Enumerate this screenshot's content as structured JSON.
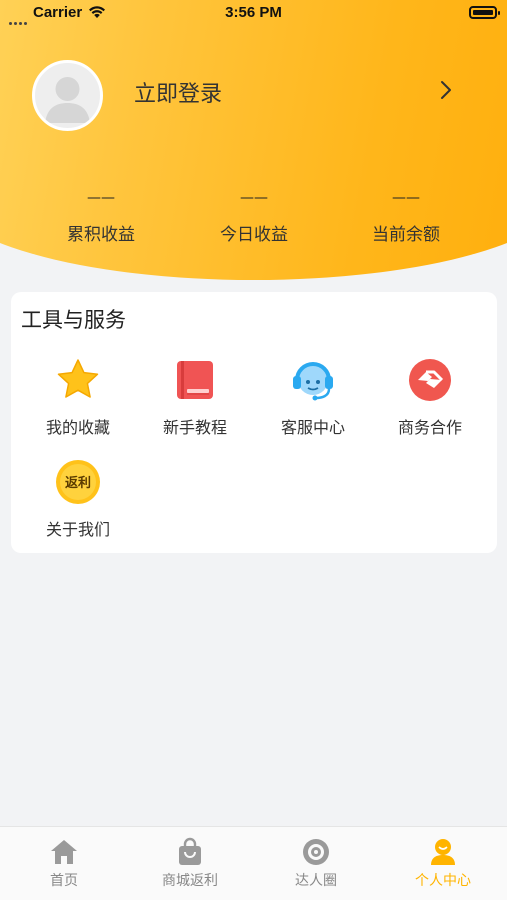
{
  "status_bar": {
    "carrier": "Carrier",
    "time": "3:56 PM"
  },
  "profile": {
    "login_label": "立即登录"
  },
  "stats": [
    {
      "value": "——",
      "label": "累积收益"
    },
    {
      "value": "——",
      "label": "今日收益"
    },
    {
      "value": "——",
      "label": "当前余额"
    }
  ],
  "tools": {
    "title": "工具与服务",
    "items": [
      {
        "label": "我的收藏",
        "icon": "star-icon"
      },
      {
        "label": "新手教程",
        "icon": "book-icon"
      },
      {
        "label": "客服中心",
        "icon": "customer-service-icon"
      },
      {
        "label": "商务合作",
        "icon": "handshake-icon"
      },
      {
        "label": "关于我们",
        "icon": "rebate-badge-icon",
        "badge_text": "返利"
      }
    ]
  },
  "tabbar": {
    "items": [
      {
        "label": "首页",
        "icon": "home-icon"
      },
      {
        "label": "商城返利",
        "icon": "shopping-bag-icon"
      },
      {
        "label": "达人圈",
        "icon": "circle-icon"
      },
      {
        "label": "个人中心",
        "icon": "user-icon",
        "active": true
      }
    ]
  },
  "colors": {
    "accent": "#ffb400",
    "header_gradient_start": "#ffd966",
    "header_gradient_end": "#ffad0a",
    "book_red": "#f05454",
    "handshake_red": "#f0574f",
    "service_blue": "#2aa9f0"
  }
}
